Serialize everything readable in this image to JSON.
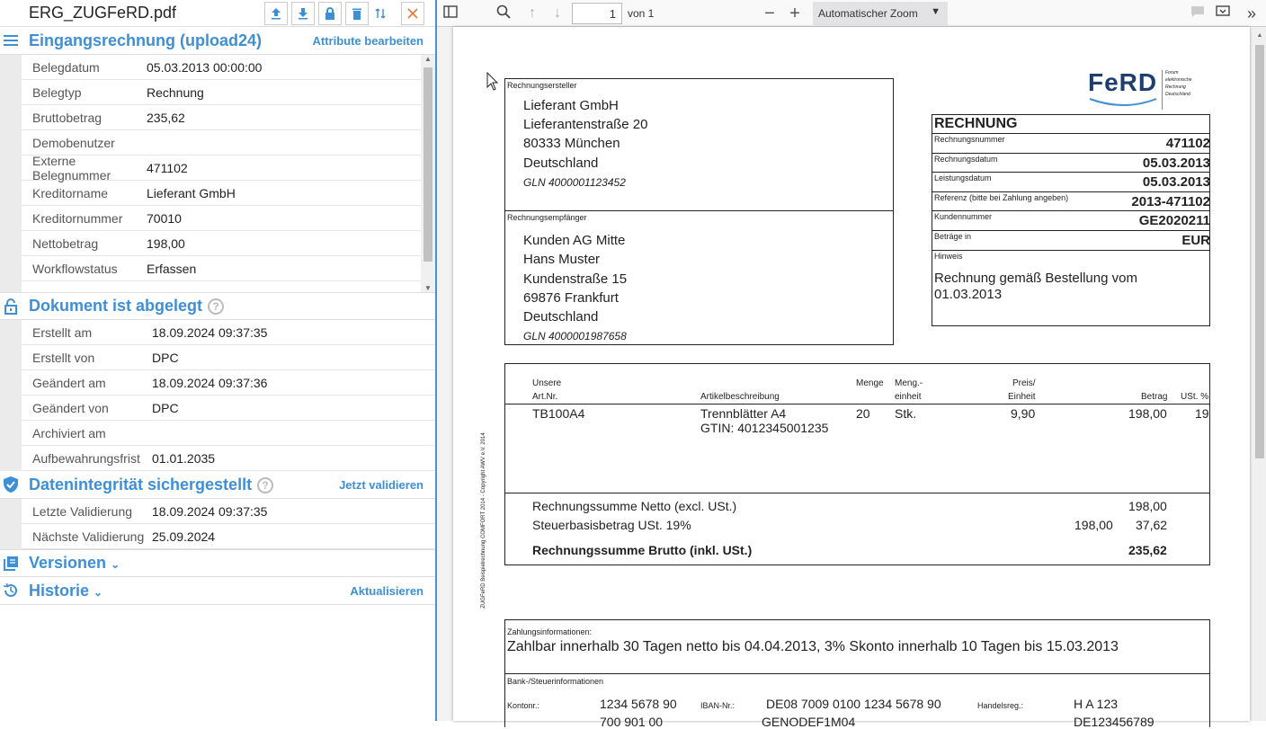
{
  "file": {
    "name": "ERG_ZUGFeRD.pdf"
  },
  "sections": {
    "attrs": {
      "title": "Eingangsrechnung (upload24)",
      "action": "Attribute bearbeiten",
      "rows": [
        {
          "k": "Belegdatum",
          "v": "05.03.2013 00:00:00"
        },
        {
          "k": "Belegtyp",
          "v": "Rechnung"
        },
        {
          "k": "Bruttobetrag",
          "v": "235,62"
        },
        {
          "k": "Demobenutzer",
          "v": ""
        },
        {
          "k": "Externe Belegnummer",
          "v": "471102"
        },
        {
          "k": "Kreditorname",
          "v": "Lieferant GmbH"
        },
        {
          "k": "Kreditornummer",
          "v": "70010"
        },
        {
          "k": "Nettobetrag",
          "v": "198,00"
        },
        {
          "k": "Workflowstatus",
          "v": "Erfassen"
        }
      ]
    },
    "doc": {
      "title": "Dokument ist abgelegt",
      "rows": [
        {
          "k": "Erstellt am",
          "v": "18.09.2024 09:37:35"
        },
        {
          "k": "Erstellt von",
          "v": "DPC"
        },
        {
          "k": "Geändert am",
          "v": "18.09.2024 09:37:36"
        },
        {
          "k": "Geändert von",
          "v": "DPC"
        },
        {
          "k": "Archiviert am",
          "v": ""
        },
        {
          "k": "Aufbewahrungsfrist",
          "v": "01.01.2035"
        }
      ]
    },
    "integ": {
      "title": "Datenintegrität sichergestellt",
      "action": "Jetzt validieren",
      "rows": [
        {
          "k": "Letzte Validierung",
          "v": "18.09.2024 09:37:35"
        },
        {
          "k": "Nächste Validierung",
          "v": "25.09.2024"
        }
      ]
    },
    "versions": {
      "title": "Versionen"
    },
    "history": {
      "title": "Historie",
      "action": "Aktualisieren"
    }
  },
  "viewer": {
    "page": "1",
    "of": "von 1",
    "zoom": "Automatischer Zoom"
  },
  "invoice": {
    "sender_label": "Rechnungsersteller",
    "sender": [
      "Lieferant GmbH",
      "Lieferantenstraße 20",
      "80333 München",
      "Deutschland"
    ],
    "sender_gln": "GLN 4000001123452",
    "recipient_label": "Rechnungsempfänger",
    "recipient": [
      "Kunden AG Mitte",
      "Hans Muster",
      "Kundenstraße 15",
      "69876 Frankfurt",
      "Deutschland"
    ],
    "recipient_gln": "GLN 4000001987658",
    "logo": "FeRD",
    "logo_sub": [
      "Forum",
      "elektronische",
      "Rechnung",
      "Deutschland"
    ],
    "head": "RECHNUNG",
    "meta": [
      {
        "k": "Rechnungsnummer",
        "v": "471102"
      },
      {
        "k": "Rechnungsdatum",
        "v": "05.03.2013"
      },
      {
        "k": "Leistungsdatum",
        "v": "05.03.2013"
      },
      {
        "k": "Referenz (bitte bei Zahlung angeben)",
        "v": "2013-471102"
      },
      {
        "k": "Kundennummer",
        "v": "GE2020211"
      },
      {
        "k": "Beträge in",
        "v": "EUR"
      }
    ],
    "hint_label": "Hinweis",
    "hint": [
      "Rechnung gemäß Bestellung vom",
      "01.03.2013"
    ],
    "cols": {
      "art1": "Unsere",
      "art2": "Art.Nr.",
      "desc": "Artikelbeschreibung",
      "qty": "Menge",
      "unit1": "Meng.-",
      "unit2": "einheit",
      "price1": "Preis/",
      "price2": "Einheit",
      "amount": "Betrag",
      "vat": "USt. %"
    },
    "item": {
      "art": "TB100A4",
      "desc1": "Trennblätter A4",
      "desc2": "GTIN: 4012345001235",
      "qty": "20",
      "unit": "Stk.",
      "price": "9,90",
      "amount": "198,00",
      "vat": "19"
    },
    "net_label": "Rechnungssumme Netto (excl. USt.)",
    "net": "198,00",
    "tax_label": "Steuerbasisbetrag USt. 19%",
    "tax_base": "198,00",
    "tax": "37,62",
    "gross_label": "Rechnungssumme Brutto (inkl. USt.)",
    "gross": "235,62",
    "side_text": "ZUGFeRD Beispielrechnung COMFORT 2014 - Copyright AWV e.V. 2014",
    "pay_label": "Zahlungsinformationen:",
    "pay": "Zahlbar innerhalb 30 Tagen netto bis 04.04.2013, 3% Skonto innerhalb 10 Tagen bis 15.03.2013",
    "bank_label": "Bank-/Steuerinformationen",
    "konto_label": "Kontonr.:",
    "konto": "1234 5678 90",
    "iban_label": "IBAN-Nr.:",
    "iban": "DE08 7009 0100 1234 5678 90",
    "hr_label": "Handelsreg.:",
    "hr": "H A 123",
    "blz": "700 901 00",
    "bic": "GENODEF1M04",
    "ust": "DE123456789"
  }
}
